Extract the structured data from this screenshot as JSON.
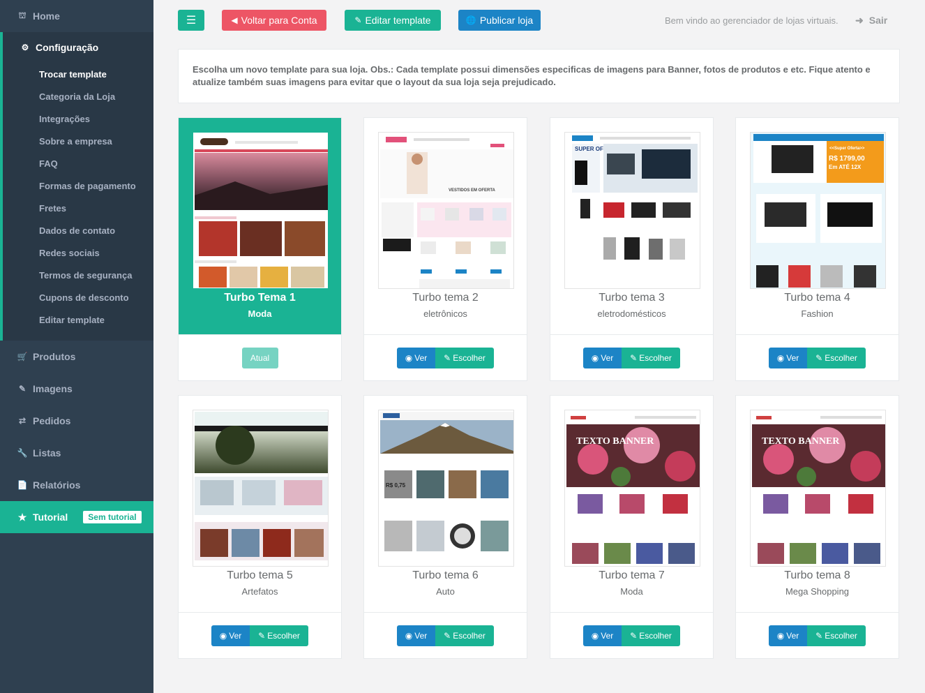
{
  "sidebar": {
    "home": "Home",
    "config": "Configuração",
    "config_items": [
      "Trocar template",
      "Categoria da Loja",
      "Integrações",
      "Sobre a empresa",
      "FAQ",
      "Formas de pagamento",
      "Fretes",
      "Dados de contato",
      "Redes sociais",
      "Termos de segurança",
      "Cupons de desconto",
      "Editar template"
    ],
    "items": [
      "Produtos",
      "Imagens",
      "Pedidos",
      "Listas",
      "Relatórios"
    ],
    "tutorial": "Tutorial",
    "tutorial_badge": "Sem tutorial"
  },
  "topbar": {
    "voltar": "Voltar para Conta",
    "editar": "Editar template",
    "publicar": "Publicar loja",
    "welcome": "Bem vindo ao gerenciador de lojas virtuais.",
    "sair": "Sair"
  },
  "notice": "Escolha um novo template para sua loja. Obs.: Cada template possui dimensões especificas de imagens para Banner, fotos de produtos e etc. Fique atento e atualize também suas imagens para evitar que o layout da sua loja seja prejudicado.",
  "buttons": {
    "ver": "Ver",
    "escolher": "Escolher",
    "atual": "Atual"
  },
  "templates": [
    {
      "name": "Turbo Tema 1",
      "category": "Moda"
    },
    {
      "name": "Turbo tema 2",
      "category": "eletrônicos"
    },
    {
      "name": "Turbo tema 3",
      "category": "eletrodomésticos"
    },
    {
      "name": "Turbo tema 4",
      "category": "Fashion"
    },
    {
      "name": "Turbo tema 5",
      "category": "Artefatos"
    },
    {
      "name": "Turbo tema 6",
      "category": "Auto"
    },
    {
      "name": "Turbo tema 7",
      "category": "Moda"
    },
    {
      "name": "Turbo tema 8",
      "category": "Mega Shopping"
    }
  ],
  "thumb_text": {
    "t2_banner": "VESTIDOS EM OFERTA",
    "t3_banner": "SUPER OFERTA",
    "t4_price": "R$ 1799,00",
    "t4_offer": "<<Super Oferta>>",
    "t4_parc": "Em ATÉ 12X",
    "t6_price": "R$ 0,75",
    "t7_banner": "TEXTO BANNER",
    "t8_banner": "TEXTO BANNER"
  },
  "colors": {
    "sidebar": "#2f4050",
    "accent": "#1ab394",
    "danger": "#ed5565",
    "primary": "#1c84c6"
  }
}
